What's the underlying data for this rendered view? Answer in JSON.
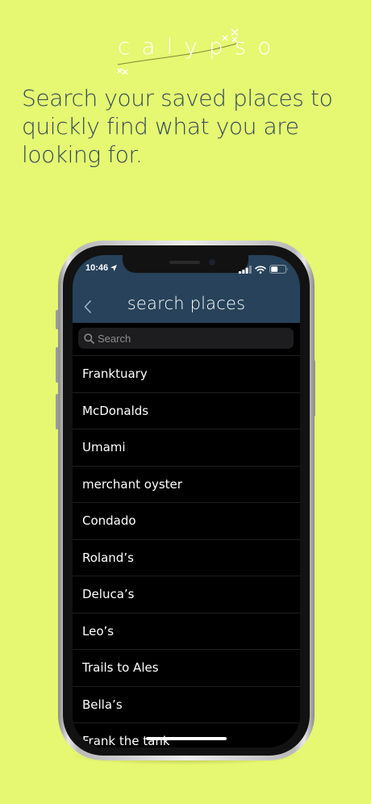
{
  "logo": {
    "text": "calypso"
  },
  "headline": "Search your saved places to quickly find what you are looking for.",
  "status_bar": {
    "time": "10:46"
  },
  "nav": {
    "title": "search places"
  },
  "search": {
    "placeholder": "Search"
  },
  "places": [
    "Franktuary",
    "McDonalds",
    "Umami",
    "merchant oyster",
    "Condado",
    "Roland’s",
    "Deluca’s",
    "Leo’s",
    "Trails to Ales",
    "Bella’s",
    "Frank the tank"
  ],
  "colors": {
    "background": "#e6f771",
    "navbar": "#27425a",
    "headline_text": "#2e4a5c",
    "list_background": "#000000"
  },
  "icons": {
    "back": "chevron-left-icon",
    "search": "magnifier-icon",
    "location": "location-arrow-icon",
    "signal": "cellular-signal-icon",
    "wifi": "wifi-icon",
    "battery": "battery-icon"
  }
}
